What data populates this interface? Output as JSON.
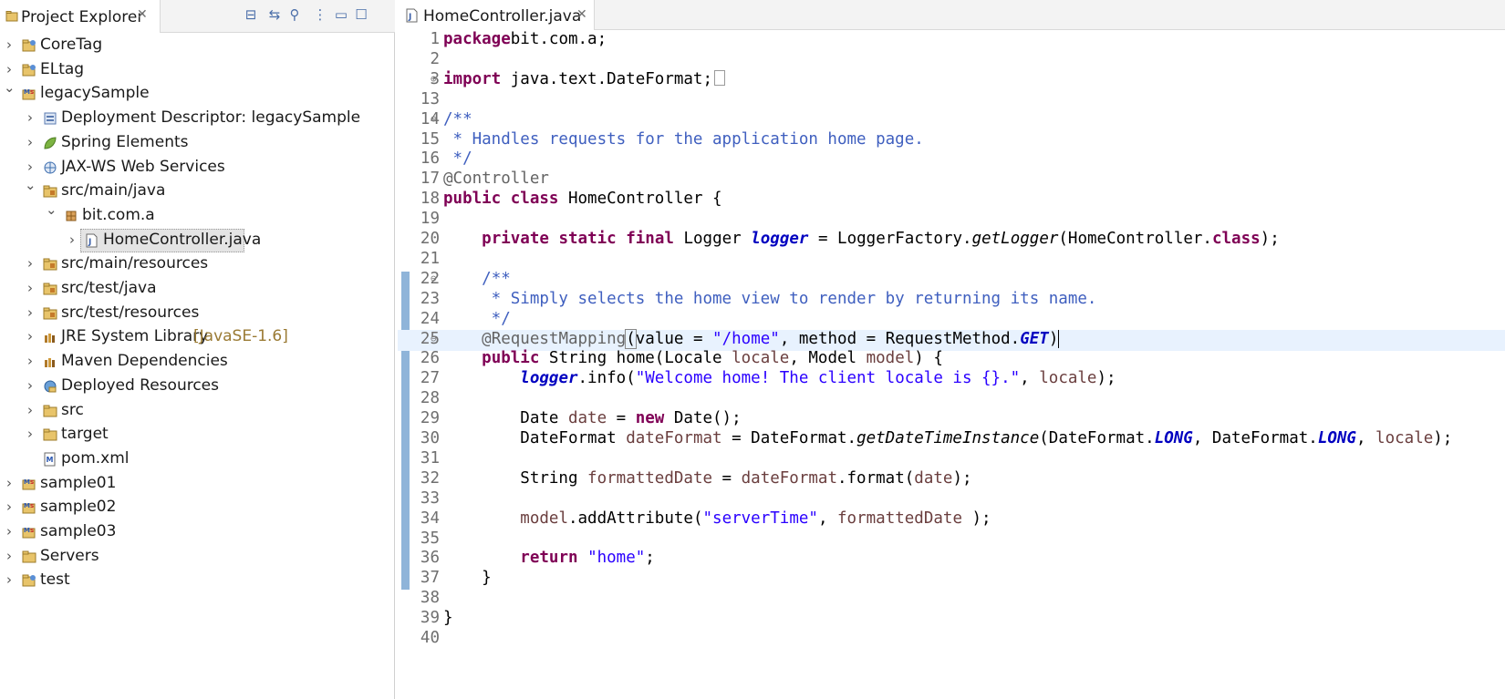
{
  "explorer": {
    "title": "Project Explorer",
    "close_glyph": "✕",
    "toolbar": [
      {
        "name": "collapse-all-icon",
        "glyph": "⊟"
      },
      {
        "name": "link-with-editor-icon",
        "glyph": "⇆"
      },
      {
        "name": "filter-icon",
        "glyph": "⚲"
      },
      {
        "name": "view-menu-icon",
        "glyph": "⋮"
      },
      {
        "name": "minimize-icon",
        "glyph": "▭"
      },
      {
        "name": "maximize-icon",
        "glyph": "☐"
      }
    ],
    "tree": [
      {
        "label": "CoreTag",
        "icon": "project-icon",
        "depth": 0,
        "expanded": false
      },
      {
        "label": "ELtag",
        "icon": "project-icon",
        "depth": 0,
        "expanded": false
      },
      {
        "label": "legacySample",
        "icon": "maven-project-icon",
        "depth": 0,
        "expanded": true
      },
      {
        "label": "Deployment Descriptor: legacySample",
        "icon": "deployment-descriptor-icon",
        "depth": 1,
        "expanded": false
      },
      {
        "label": "Spring Elements",
        "icon": "spring-leaf-icon",
        "depth": 1,
        "expanded": false
      },
      {
        "label": "JAX-WS Web Services",
        "icon": "web-services-icon",
        "depth": 1,
        "expanded": false
      },
      {
        "label": "src/main/java",
        "icon": "source-folder-icon",
        "depth": 1,
        "expanded": true
      },
      {
        "label": "bit.com.a",
        "icon": "package-icon",
        "depth": 2,
        "expanded": true
      },
      {
        "label": "HomeController.java",
        "icon": "java-file-icon",
        "depth": 3,
        "expanded": false,
        "selected": true
      },
      {
        "label": "src/main/resources",
        "icon": "source-folder-icon",
        "depth": 1,
        "expanded": false
      },
      {
        "label": "src/test/java",
        "icon": "source-folder-icon",
        "depth": 1,
        "expanded": false
      },
      {
        "label": "src/test/resources",
        "icon": "source-folder-icon",
        "depth": 1,
        "expanded": false
      },
      {
        "label": "JRE System Library",
        "decoration": "[JavaSE-1.6]",
        "icon": "library-icon",
        "depth": 1,
        "expanded": false
      },
      {
        "label": "Maven Dependencies",
        "icon": "library-icon",
        "depth": 1,
        "expanded": false
      },
      {
        "label": "Deployed Resources",
        "icon": "deployed-resources-icon",
        "depth": 1,
        "expanded": false
      },
      {
        "label": "src",
        "icon": "folder-icon",
        "depth": 1,
        "expanded": false
      },
      {
        "label": "target",
        "icon": "folder-icon",
        "depth": 1,
        "expanded": false
      },
      {
        "label": "pom.xml",
        "icon": "maven-pom-icon",
        "depth": 1,
        "expanded": null
      },
      {
        "label": "sample01",
        "icon": "maven-project-icon",
        "depth": 0,
        "expanded": false
      },
      {
        "label": "sample02",
        "icon": "maven-project-icon",
        "depth": 0,
        "expanded": false
      },
      {
        "label": "sample03",
        "icon": "maven-project-icon",
        "depth": 0,
        "expanded": false
      },
      {
        "label": "Servers",
        "icon": "folder-icon",
        "depth": 0,
        "expanded": false
      },
      {
        "label": "test",
        "icon": "project-icon",
        "depth": 0,
        "expanded": false
      }
    ]
  },
  "editor": {
    "tab_title": "HomeController.java",
    "close_glyph": "✕",
    "current_line": 25,
    "lines": [
      {
        "n": "1",
        "tokens": [
          [
            "kw",
            "package"
          ],
          [
            "",
            "bit.com.a;"
          ]
        ]
      },
      {
        "n": "2",
        "tokens": []
      },
      {
        "n": "3",
        "fold": "⊕",
        "tokens": [
          [
            "kw",
            "import"
          ],
          [
            "",
            " java.text.DateFormat;"
          ],
          [
            "box",
            ""
          ]
        ]
      },
      {
        "n": "13",
        "tokens": []
      },
      {
        "n": "14",
        "fold": "⊖",
        "tokens": [
          [
            "cmt",
            "/**"
          ]
        ]
      },
      {
        "n": "15",
        "tokens": [
          [
            "cmt",
            " * Handles requests for the application home page."
          ]
        ]
      },
      {
        "n": "16",
        "tokens": [
          [
            "cmt",
            " */"
          ]
        ]
      },
      {
        "n": "17",
        "tokens": [
          [
            "ann",
            "@Controller"
          ]
        ]
      },
      {
        "n": "18",
        "tokens": [
          [
            "kw",
            "public"
          ],
          [
            "",
            " "
          ],
          [
            "kw",
            "class"
          ],
          [
            "",
            " HomeController {"
          ]
        ]
      },
      {
        "n": "19",
        "tokens": []
      },
      {
        "n": "20",
        "tokens": [
          [
            "",
            "    "
          ],
          [
            "kw",
            "private"
          ],
          [
            "",
            " "
          ],
          [
            "kw",
            "static"
          ],
          [
            "",
            " "
          ],
          [
            "kw",
            "final"
          ],
          [
            "",
            " Logger "
          ],
          [
            "field-static",
            "logger"
          ],
          [
            "",
            " = LoggerFactory."
          ],
          [
            "static-call",
            "getLogger"
          ],
          [
            "",
            "(HomeController."
          ],
          [
            "kw",
            "class"
          ],
          [
            "",
            ");"
          ]
        ]
      },
      {
        "n": "21",
        "tokens": []
      },
      {
        "n": "22",
        "fold": "⊖",
        "tokens": [
          [
            "",
            "    "
          ],
          [
            "cmt",
            "/**"
          ]
        ]
      },
      {
        "n": "23",
        "tokens": [
          [
            "cmt",
            "     * Simply selects the home view to render by returning its name."
          ]
        ]
      },
      {
        "n": "24",
        "tokens": [
          [
            "cmt",
            "     */"
          ]
        ]
      },
      {
        "n": "25",
        "fold": "⊖",
        "tokens": [
          [
            "",
            "    "
          ],
          [
            "ann",
            "@RequestMapping"
          ],
          [
            "bracket",
            "("
          ],
          [
            "",
            "value = "
          ],
          [
            "str",
            "\"/home\""
          ],
          [
            "",
            ", method = RequestMethod."
          ],
          [
            "const",
            "GET"
          ],
          [
            "caret",
            ")"
          ]
        ]
      },
      {
        "n": "26",
        "tokens": [
          [
            "",
            "    "
          ],
          [
            "kw",
            "public"
          ],
          [
            "",
            " String home(Locale "
          ],
          [
            "local",
            "locale"
          ],
          [
            "",
            ", Model "
          ],
          [
            "local",
            "model"
          ],
          [
            "",
            ") {"
          ]
        ]
      },
      {
        "n": "27",
        "tokens": [
          [
            "",
            "        "
          ],
          [
            "field-static",
            "logger"
          ],
          [
            "",
            ".info("
          ],
          [
            "str",
            "\"Welcome home! The client locale is {}.\""
          ],
          [
            "",
            ", "
          ],
          [
            "local",
            "locale"
          ],
          [
            "",
            ");"
          ]
        ]
      },
      {
        "n": "28",
        "tokens": []
      },
      {
        "n": "29",
        "tokens": [
          [
            "",
            "        Date "
          ],
          [
            "local",
            "date"
          ],
          [
            "",
            " = "
          ],
          [
            "kw",
            "new"
          ],
          [
            "",
            " Date();"
          ]
        ]
      },
      {
        "n": "30",
        "tokens": [
          [
            "",
            "        DateFormat "
          ],
          [
            "local",
            "dateFormat"
          ],
          [
            "",
            " = DateFormat."
          ],
          [
            "static-call",
            "getDateTimeInstance"
          ],
          [
            "",
            "(DateFormat."
          ],
          [
            "const",
            "LONG"
          ],
          [
            "",
            ", DateFormat."
          ],
          [
            "const",
            "LONG"
          ],
          [
            "",
            ", "
          ],
          [
            "local",
            "locale"
          ],
          [
            "",
            ");"
          ]
        ]
      },
      {
        "n": "31",
        "tokens": []
      },
      {
        "n": "32",
        "tokens": [
          [
            "",
            "        String "
          ],
          [
            "local",
            "formattedDate"
          ],
          [
            "",
            " = "
          ],
          [
            "local",
            "dateFormat"
          ],
          [
            "",
            ".format("
          ],
          [
            "local",
            "date"
          ],
          [
            "",
            ");"
          ]
        ]
      },
      {
        "n": "33",
        "tokens": []
      },
      {
        "n": "34",
        "tokens": [
          [
            "",
            "        "
          ],
          [
            "local",
            "model"
          ],
          [
            "",
            ".addAttribute("
          ],
          [
            "str",
            "\"serverTime\""
          ],
          [
            "",
            ", "
          ],
          [
            "local",
            "formattedDate"
          ],
          [
            "",
            " );"
          ]
        ]
      },
      {
        "n": "35",
        "tokens": []
      },
      {
        "n": "36",
        "tokens": [
          [
            "",
            "        "
          ],
          [
            "kw",
            "return"
          ],
          [
            "",
            " "
          ],
          [
            "str",
            "\"home\""
          ],
          [
            "",
            ";"
          ]
        ]
      },
      {
        "n": "37",
        "tokens": [
          [
            "",
            "    }"
          ]
        ]
      },
      {
        "n": "38",
        "tokens": []
      },
      {
        "n": "39",
        "tokens": [
          [
            "",
            "}"
          ]
        ]
      },
      {
        "n": "40",
        "tokens": []
      }
    ]
  }
}
